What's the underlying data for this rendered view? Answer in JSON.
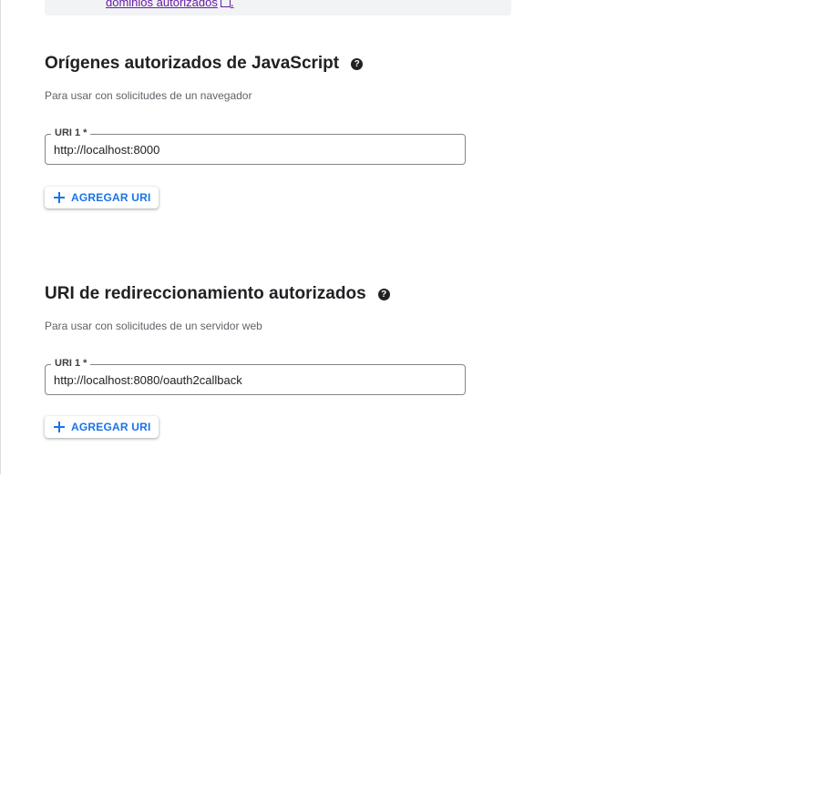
{
  "info_box": {
    "link_text": "dominios autorizados",
    "tail": "."
  },
  "sections": [
    {
      "title": "Orígenes autorizados de JavaScript",
      "help_icon": "help-icon",
      "subtitle": "Para usar con solicitudes de un navegador",
      "field": {
        "label": "URI 1 *",
        "value": "http://localhost:8000"
      },
      "add_button_label": "AGREGAR URI"
    },
    {
      "title": "URI de redireccionamiento autorizados",
      "help_icon": "help-icon",
      "subtitle": "Para usar con solicitudes de un servidor web",
      "field": {
        "label": "URI 1 *",
        "value": "http://localhost:8080/oauth2callback"
      },
      "add_button_label": "AGREGAR URI"
    }
  ],
  "colors": {
    "accent": "#1a73e8",
    "link_visited": "#681da8",
    "info_box_bg": "#f1f3f4"
  }
}
